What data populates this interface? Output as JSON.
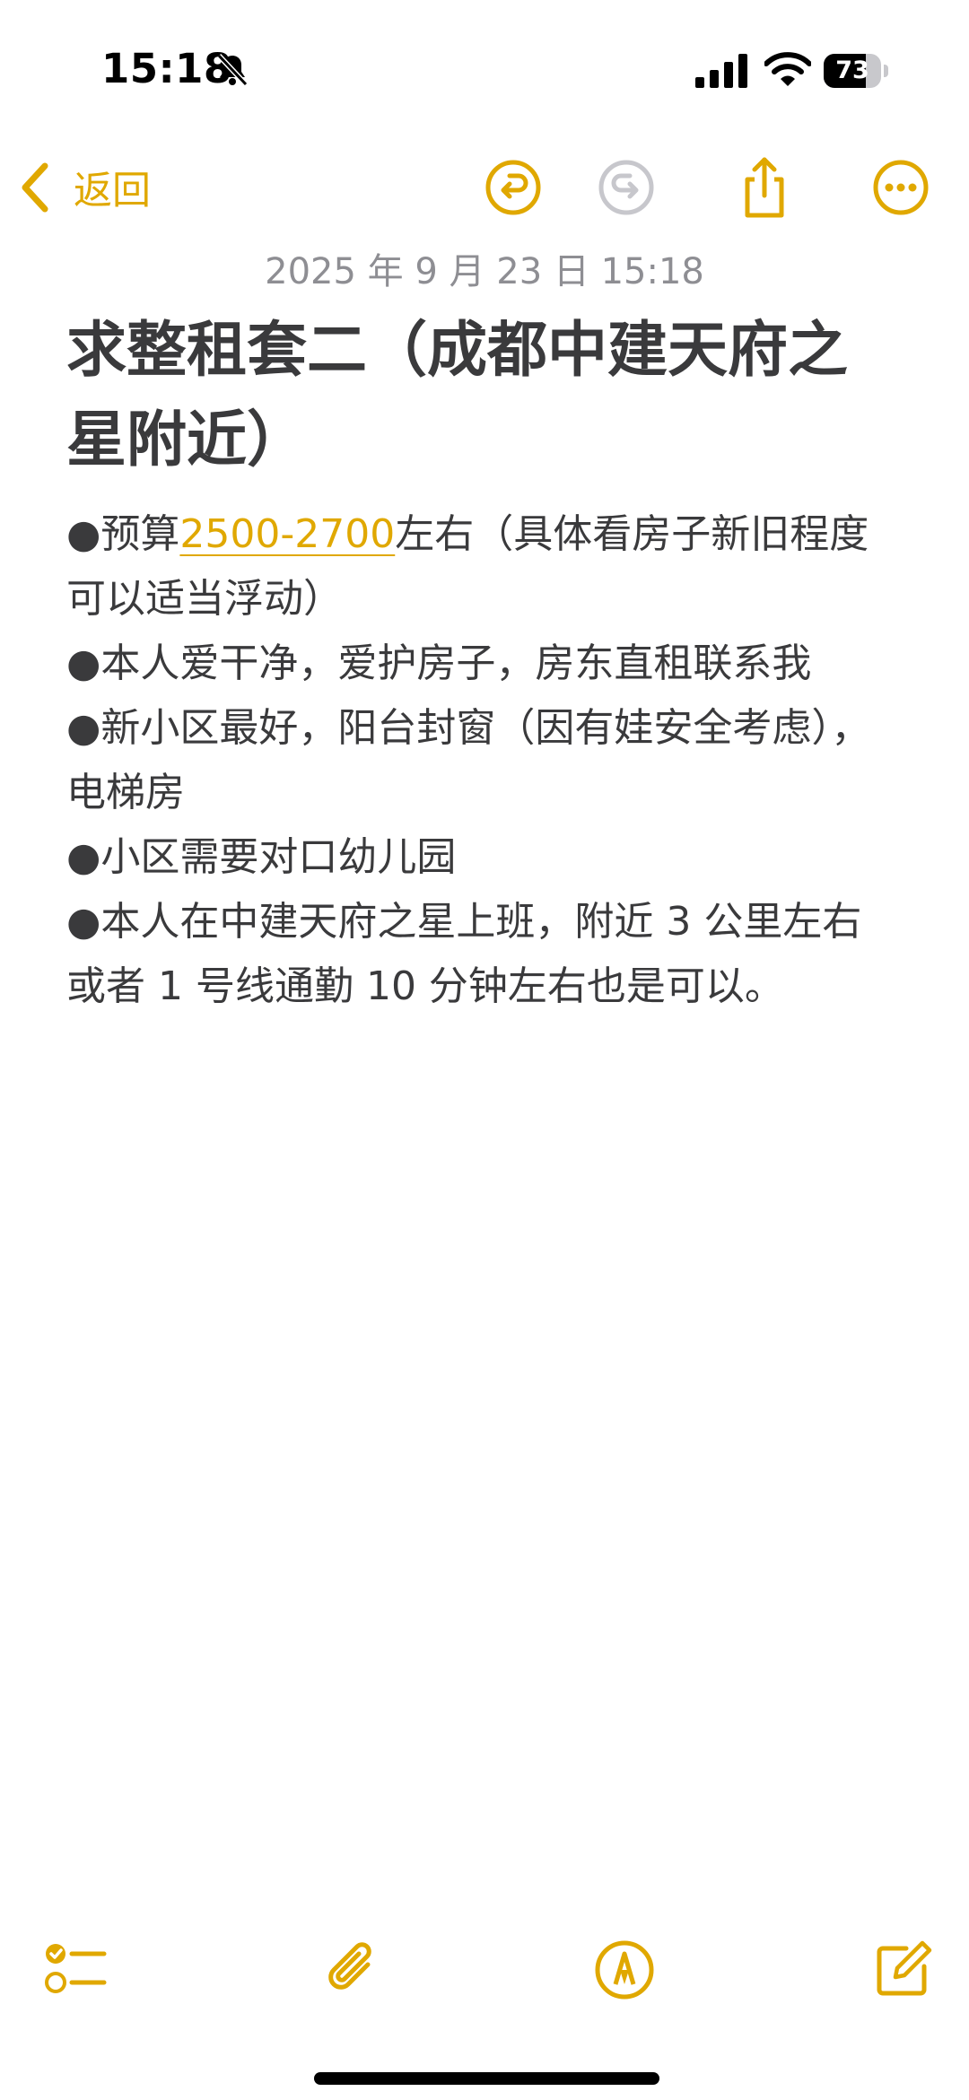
{
  "status_bar": {
    "time": "15:18",
    "battery_percent": "73",
    "battery_level": 0.73,
    "icons": [
      "bell-slash-icon",
      "cellular-signal-icon",
      "wifi-icon",
      "battery-icon"
    ]
  },
  "nav": {
    "back_label": "返回",
    "icons": [
      "chevron-left-icon",
      "undo-icon",
      "redo-icon",
      "share-icon",
      "more-icon"
    ]
  },
  "note": {
    "date": "2025 年 9 月 23 日 15:18",
    "title": "求整租套二（成都中建天府之星附近）",
    "title_lines": [
      "求整租套二（成都中建天府之",
      "星附近）"
    ],
    "lines": [
      {
        "pre": "●预算",
        "link": "2500-2700",
        "post": "左右（具体看房子新旧程度"
      },
      {
        "text": "可以适当浮动）"
      },
      {
        "text": "●本人爱干净，爱护房子，房东直租联系我"
      },
      {
        "text": "●新小区最好，阳台封窗（因有娃安全考虑），"
      },
      {
        "text": "电梯房"
      },
      {
        "text": "●小区需要对口幼儿园"
      },
      {
        "text": "●本人在中建天府之星上班，附近 3 公里左右"
      },
      {
        "text": "或者 1 号线通勤 10 分钟左右也是可以。"
      }
    ]
  },
  "toolbar": {
    "icons": [
      "checklist-icon",
      "attachment-icon",
      "markup-icon",
      "compose-icon"
    ]
  },
  "colors": {
    "accent": "#e0a800",
    "text": "#3a3a3c",
    "date": "#8e8e93",
    "disabled": "#c7c7cc"
  }
}
